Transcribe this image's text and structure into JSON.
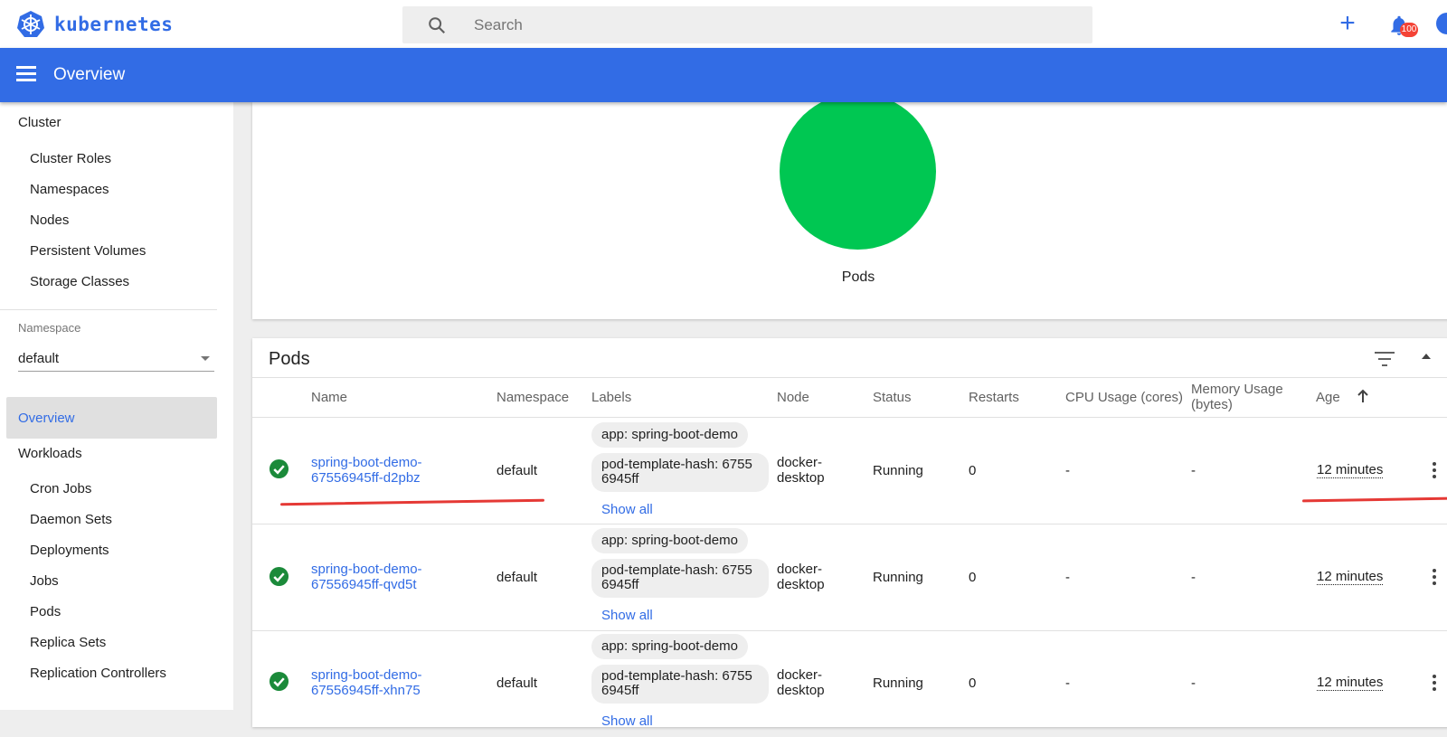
{
  "app": {
    "brand": "kubernetes",
    "page_title": "Overview"
  },
  "search": {
    "placeholder": "Search"
  },
  "notifications": {
    "count": "100"
  },
  "sidebar": {
    "cluster_heading": "Cluster",
    "cluster_items": [
      "Cluster Roles",
      "Namespaces",
      "Nodes",
      "Persistent Volumes",
      "Storage Classes"
    ],
    "namespace_label": "Namespace",
    "namespace_value": "default",
    "overview": "Overview",
    "workloads_heading": "Workloads",
    "workload_items": [
      "Cron Jobs",
      "Daemon Sets",
      "Deployments",
      "Jobs",
      "Pods",
      "Replica Sets",
      "Replication Controllers"
    ]
  },
  "chart_card": {
    "label": "Pods",
    "color": "#00c752"
  },
  "pods_card": {
    "title": "Pods",
    "columns": [
      "Name",
      "Namespace",
      "Labels",
      "Node",
      "Status",
      "Restarts",
      "CPU Usage (cores)",
      "Memory Usage (bytes)",
      "Age"
    ],
    "rows": [
      {
        "name_line1": "spring-boot-demo-",
        "name_line2": "67556945ff-d2pbz",
        "namespace": "default",
        "label1": "app: spring-boot-demo",
        "label2_line1": "pod-template-hash: 6755",
        "label2_line2": "6945ff",
        "show_all": "Show all",
        "node_line1": "docker-",
        "node_line2": "desktop",
        "status": "Running",
        "restarts": "0",
        "cpu": "-",
        "memory": "-",
        "age": "12 minutes"
      },
      {
        "name_line1": "spring-boot-demo-",
        "name_line2": "67556945ff-qvd5t",
        "namespace": "default",
        "label1": "app: spring-boot-demo",
        "label2_line1": "pod-template-hash: 6755",
        "label2_line2": "6945ff",
        "show_all": "Show all",
        "node_line1": "docker-",
        "node_line2": "desktop",
        "status": "Running",
        "restarts": "0",
        "cpu": "-",
        "memory": "-",
        "age": "12 minutes"
      },
      {
        "name_line1": "spring-boot-demo-",
        "name_line2": "67556945ff-xhn75",
        "namespace": "default",
        "label1": "app: spring-boot-demo",
        "label2_line1": "pod-template-hash: 6755",
        "label2_line2": "6945ff",
        "show_all": "Show all",
        "node_line1": "docker-",
        "node_line2": "desktop",
        "status": "Running",
        "restarts": "0",
        "cpu": "-",
        "memory": "-",
        "age": "12 minutes"
      }
    ]
  },
  "colors": {
    "accent": "#326ce5",
    "running": "#1b8a3a",
    "annotation": "#e53935"
  }
}
